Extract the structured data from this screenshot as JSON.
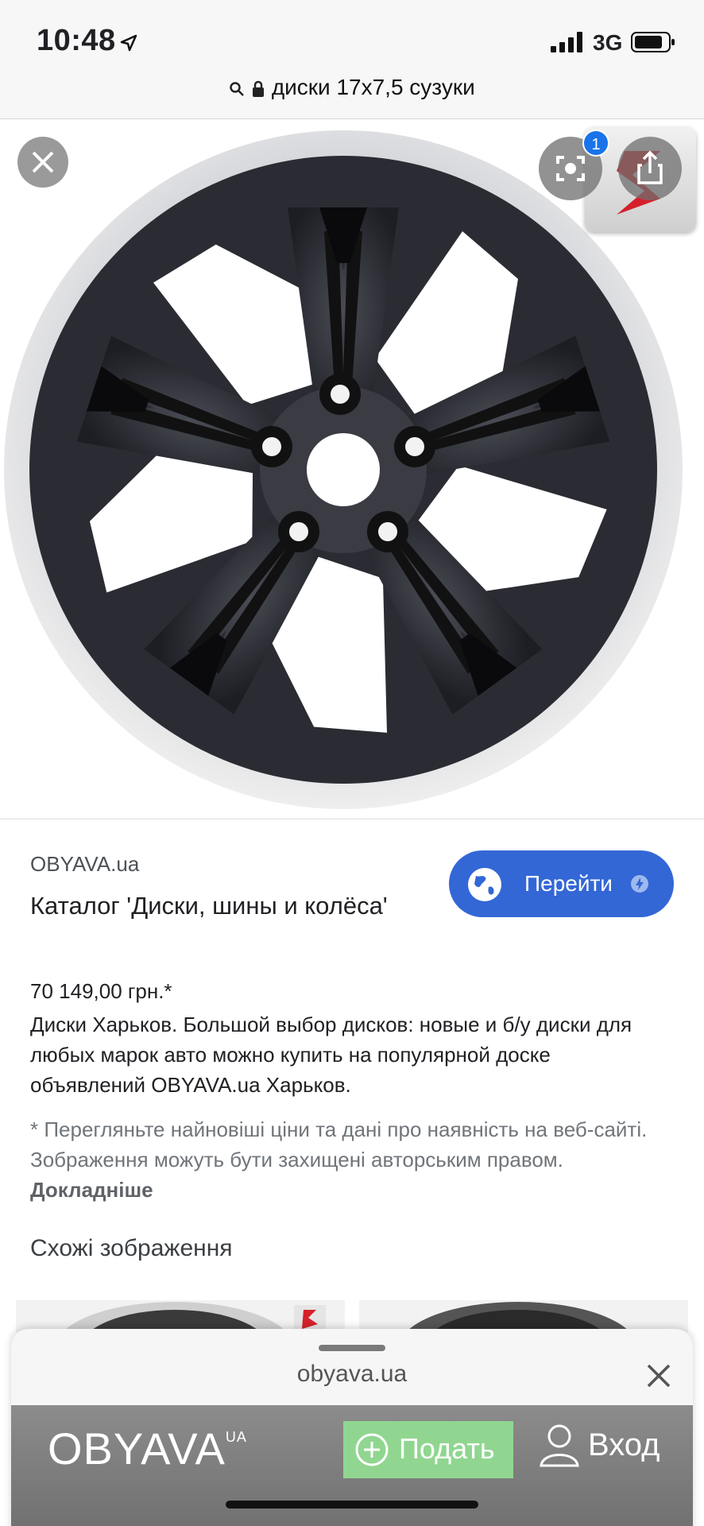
{
  "status_bar": {
    "time": "10:48",
    "network": "3G"
  },
  "url_bar": {
    "query": "диски 17x7,5 сузуки"
  },
  "viewer": {
    "lens_badge": "1"
  },
  "result": {
    "source": "OBYAVA.ua",
    "title": "Каталог 'Диски, шины и колёса'",
    "go_label": "Перейти",
    "price": "70 149,00 грн.*",
    "description": "Диски Харьков. Большой выбор дисков: новые и б/у диски для любых марок авто можно купить на популярной доске объявлений OBYAVA.ua Харьков.",
    "note": "* Перегляньте найновіші ціни та дані про наявність на веб-сайті. Зображення можуть бути захищені авторським правом.",
    "note_link": "Докладніше",
    "similar_heading": "Схожі зображення"
  },
  "sheet": {
    "url": "obyava.ua",
    "site_logo": "OBYAVA",
    "site_logo_tld": "UA",
    "post_label": "Подать",
    "login_label": "Вход"
  },
  "colors": {
    "accent": "#3367d6",
    "post": "#90d690",
    "badge": "#1a73e8"
  }
}
